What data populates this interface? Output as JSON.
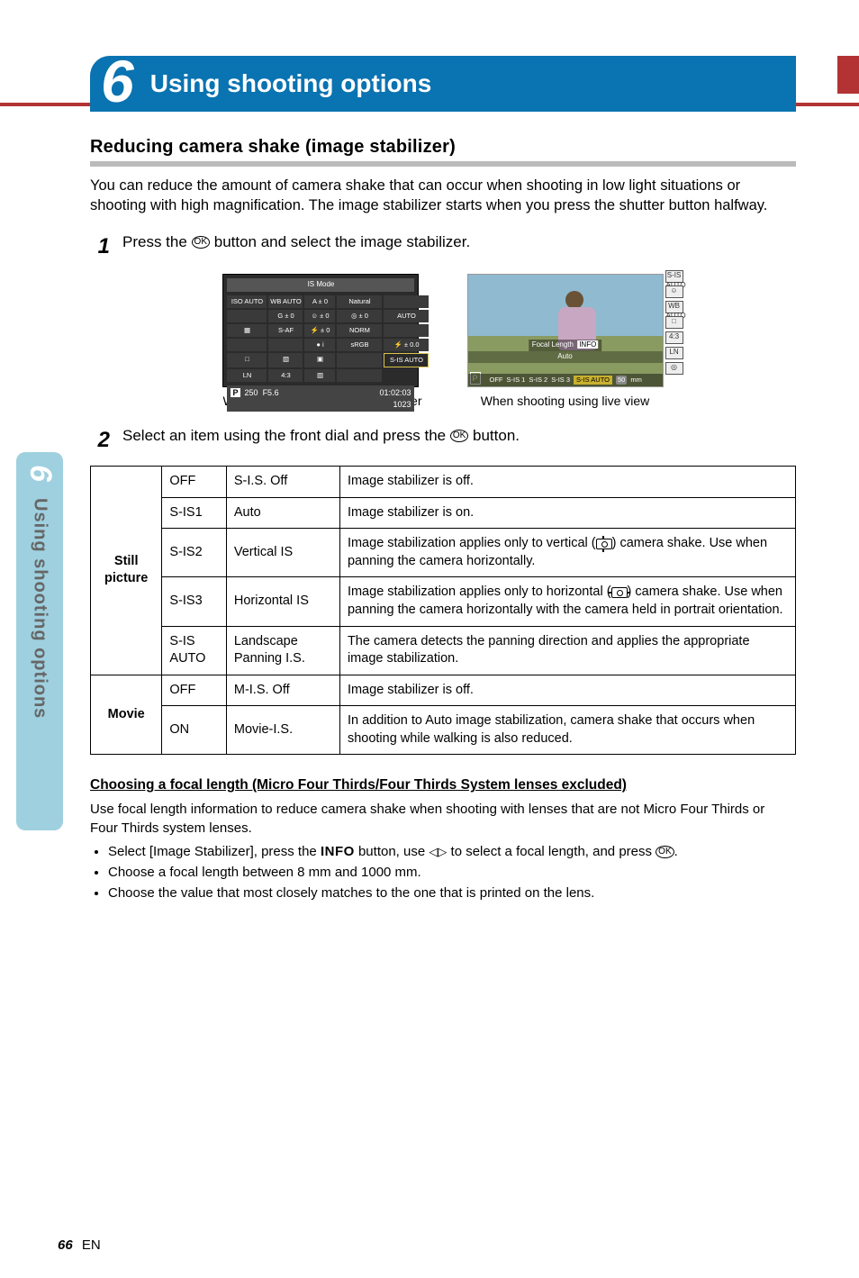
{
  "chapter": {
    "number": "6",
    "title": "Using shooting options"
  },
  "section_title": "Reducing camera shake (image stabilizer)",
  "intro": "You can reduce the amount of camera shake that can occur when shooting in low light situations or shooting with high magnification. The image stabilizer starts when you press the shutter button halfway.",
  "steps": [
    {
      "n": "1",
      "text_before": "Press the ",
      "text_after": " button and select the image stabilizer."
    },
    {
      "n": "2",
      "text_before": "Select an item using the front dial and press the ",
      "text_after": " button."
    }
  ],
  "ok_label": "OK",
  "viewfinder": {
    "title": "IS Mode",
    "cells": [
      "ISO AUTO",
      "WB AUTO",
      "A ± 0",
      "Natural",
      "",
      "",
      "G ± 0",
      "☺ ± 0",
      "◎ ± 0",
      "AUTO",
      "▦",
      "S-AF",
      "⚡ ± 0",
      "NORM",
      "",
      "",
      "",
      "● i",
      "sRGB",
      "⚡ ± 0.0",
      "□",
      "▧",
      "▣",
      "",
      "S-IS AUTO",
      "LN",
      "4:3",
      "▥",
      ""
    ],
    "bottom_p": "P",
    "bottom_shutter": "250",
    "bottom_aperture": "F5.6",
    "bottom_time": "01:02:03",
    "bottom_shots": "1023",
    "caption": "When shooting using the viewfinder"
  },
  "liveview": {
    "focal": "Focal Length",
    "info_tag": "INFO",
    "auto": "Auto",
    "icons": [
      "S-IS AUTO",
      "☺",
      "WB AUTO",
      "□",
      "4:3",
      "LN",
      "◎"
    ],
    "bottom_p": "P",
    "bottom_items": [
      "OFF",
      "S-IS 1",
      "S-IS 2",
      "S-IS 3",
      "S-IS AUTO",
      "50",
      "mm"
    ],
    "caption": "When shooting using live view"
  },
  "table": {
    "groups": [
      {
        "head": "Still picture",
        "rows": [
          {
            "c1": "OFF",
            "c2": "S-I.S. Off",
            "desc": "Image stabilizer is off."
          },
          {
            "c1": "S-IS1",
            "c2": "Auto",
            "desc": "Image stabilizer is on."
          },
          {
            "c1": "S-IS2",
            "c2": "Vertical IS",
            "desc_pre": "Image stabilization applies only to vertical (",
            "desc_post": ") camera shake. Use when panning the camera horizontally.",
            "icon": "vert"
          },
          {
            "c1": "S-IS3",
            "c2": "Horizontal IS",
            "desc_pre": "Image stabilization applies only to horizontal (",
            "desc_post": ") camera shake. Use when panning the camera horizontally with the camera held in portrait orientation.",
            "icon": "horz"
          },
          {
            "c1": "S-IS AUTO",
            "c2": "Landscape Panning I.S.",
            "desc": "The camera detects the panning direction and applies the appropriate image stabilization."
          }
        ]
      },
      {
        "head": "Movie",
        "rows": [
          {
            "c1": "OFF",
            "c2": "M-I.S. Off",
            "desc": "Image stabilizer is off."
          },
          {
            "c1": "ON",
            "c2": "Movie-I.S.",
            "desc": "In addition to Auto image stabilization, camera shake that occurs when shooting while walking is also reduced."
          }
        ]
      }
    ]
  },
  "sub_heading": "Choosing a focal length (Micro Four Thirds/Four Thirds System lenses excluded)",
  "sub_body": "Use focal length information to reduce camera shake when shooting with lenses that are not Micro Four Thirds or Four Thirds system lenses.",
  "bullets": [
    {
      "pre": "Select [Image Stabilizer], press the ",
      "info": "INFO",
      "mid": " button, use ",
      "tri": "◁▷",
      "mid2": " to select a focal length, and press ",
      "ok": true,
      "post": "."
    },
    {
      "text": "Choose a focal length between 8 mm and 1000 mm."
    },
    {
      "text": "Choose the value that most closely matches to the one that is printed on the lens."
    }
  ],
  "sidebar": {
    "num": "6",
    "label": "Using shooting options"
  },
  "footer": {
    "page": "66",
    "lang": "EN"
  }
}
